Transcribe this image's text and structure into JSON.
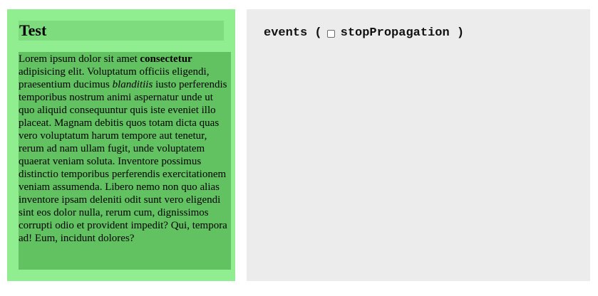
{
  "left_card": {
    "title": "Test",
    "paragraph": {
      "p1": "Lorem ipsum dolor sit amet ",
      "bold": "consectetur",
      "p2": " adipisicing elit. Voluptatum officiis eligendi, praesentium ducimus ",
      "italic": "blanditiis",
      "p3": " iusto perferendis temporibus nostrum animi aspernatur unde ut quo aliquid consequuntur quis iste eveniet illo placeat. Magnam debitis quos totam dicta quas vero voluptatum harum tempore aut tenetur, rerum ad nam ullam fugit, unde voluptatem quaerat veniam soluta. Inventore possimus distinctio temporibus perferendis exercitationem veniam assumenda. Libero nemo non quo alias inventore ipsam deleniti odit sunt vero eligendi sint eos dolor nulla, rerum cum, dignissimos corrupti odio et provident impedit? Qui, tempora ad! Eum, incidunt dolores?"
    }
  },
  "right_panel": {
    "events_label": "events",
    "open_paren": "(",
    "checkbox": {
      "label": "stopPropagation",
      "checked": false
    },
    "close_paren": ")"
  }
}
